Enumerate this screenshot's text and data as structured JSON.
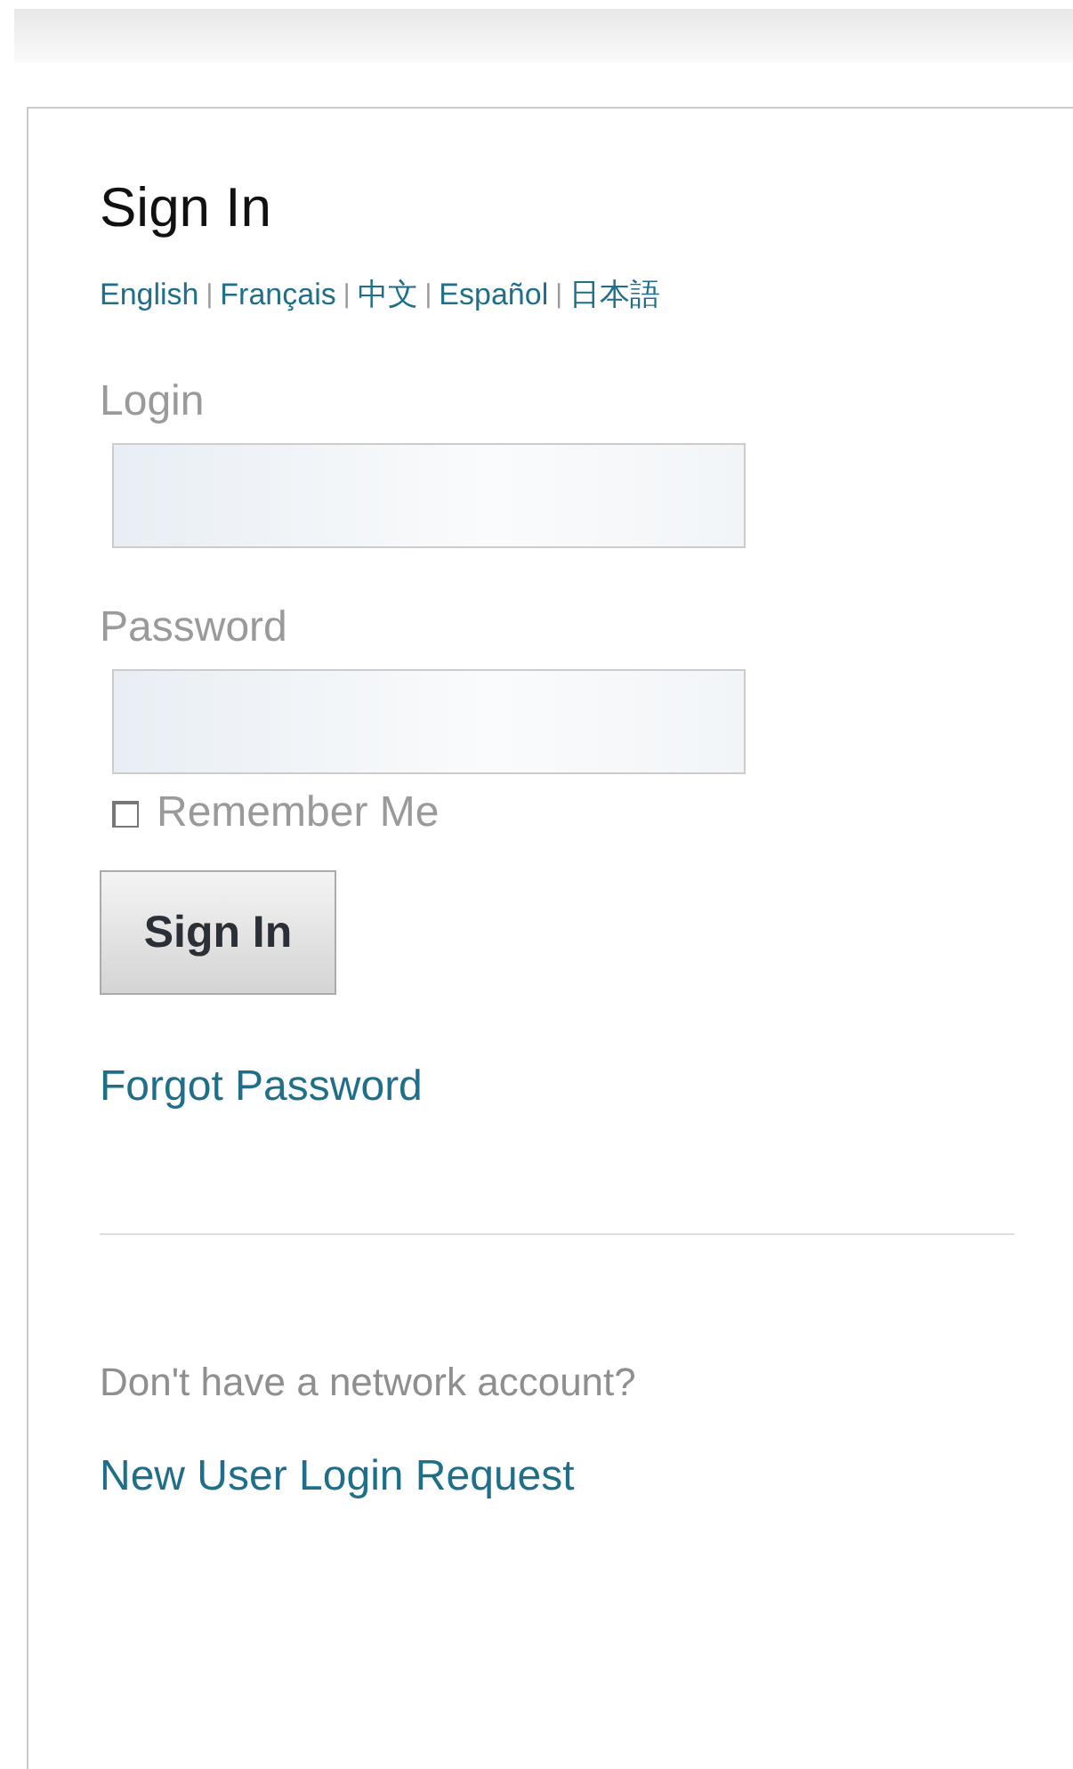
{
  "title": "Sign In",
  "languages": [
    {
      "label": "English"
    },
    {
      "label": "Français"
    },
    {
      "label": "中文"
    },
    {
      "label": "Español"
    },
    {
      "label": "日本語"
    }
  ],
  "language_separators": [
    "|",
    "|",
    "|",
    "|"
  ],
  "fields": [
    {
      "label": "Login"
    },
    {
      "label": "Password"
    }
  ],
  "remember_me": {
    "label": "Remember Me",
    "checked": false
  },
  "sign_in_button": "Sign In",
  "forgot_password": "Forgot Password",
  "signup_prompt": "Don't have a network account?",
  "signup_link": "New User Login Request"
}
